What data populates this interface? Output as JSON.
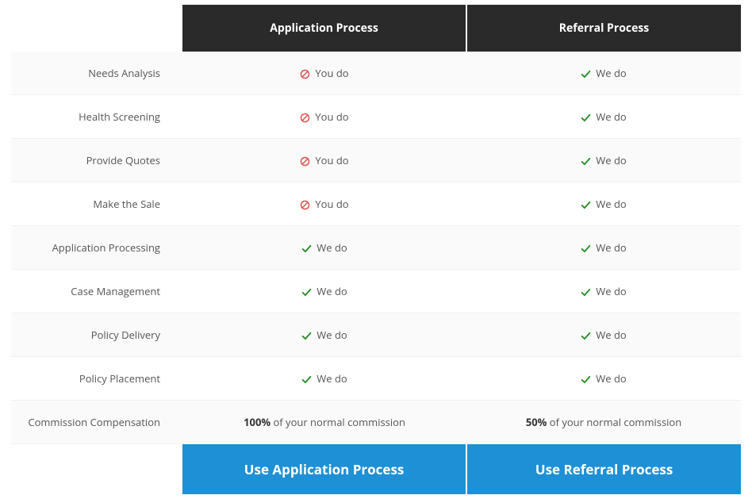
{
  "headers": {
    "col1": "Application Process",
    "col2": "Referral Process"
  },
  "labels": {
    "you_do": "You do",
    "we_do": "We do"
  },
  "rows": [
    {
      "label": "Needs Analysis",
      "app": {
        "icon": "no",
        "text": "you_do"
      },
      "ref": {
        "icon": "yes",
        "text": "we_do"
      }
    },
    {
      "label": "Health Screening",
      "app": {
        "icon": "no",
        "text": "you_do"
      },
      "ref": {
        "icon": "yes",
        "text": "we_do"
      }
    },
    {
      "label": "Provide Quotes",
      "app": {
        "icon": "no",
        "text": "you_do"
      },
      "ref": {
        "icon": "yes",
        "text": "we_do"
      }
    },
    {
      "label": "Make the Sale",
      "app": {
        "icon": "no",
        "text": "you_do"
      },
      "ref": {
        "icon": "yes",
        "text": "we_do"
      }
    },
    {
      "label": "Application Processing",
      "app": {
        "icon": "yes",
        "text": "we_do"
      },
      "ref": {
        "icon": "yes",
        "text": "we_do"
      }
    },
    {
      "label": "Case Management",
      "app": {
        "icon": "yes",
        "text": "we_do"
      },
      "ref": {
        "icon": "yes",
        "text": "we_do"
      }
    },
    {
      "label": "Policy Delivery",
      "app": {
        "icon": "yes",
        "text": "we_do"
      },
      "ref": {
        "icon": "yes",
        "text": "we_do"
      }
    },
    {
      "label": "Policy Placement",
      "app": {
        "icon": "yes",
        "text": "we_do"
      },
      "ref": {
        "icon": "yes",
        "text": "we_do"
      }
    }
  ],
  "commission_row": {
    "label": "Commission Compensation",
    "app": {
      "bold": "100%",
      "rest": " of your normal commission"
    },
    "ref": {
      "bold": "50%",
      "rest": " of your normal commission"
    }
  },
  "cta": {
    "app": "Use Application Process",
    "ref": "Use Referral Process"
  },
  "colors": {
    "no_icon": "#d9534f",
    "yes_icon": "#228B22",
    "cta_bg": "#1e90d6"
  }
}
